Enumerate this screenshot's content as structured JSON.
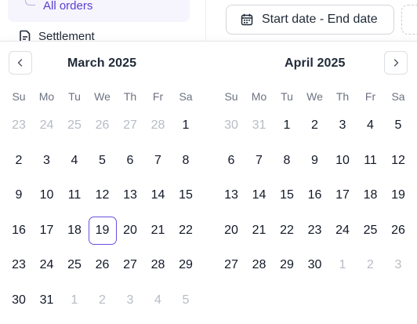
{
  "sidebar": {
    "active_item": "All orders",
    "next_item": "Settlement"
  },
  "toolbar": {
    "date_range_placeholder": "Start date - End date"
  },
  "calendar": {
    "weekdays": [
      "Su",
      "Mo",
      "Tu",
      "We",
      "Th",
      "Fr",
      "Sa"
    ],
    "months": [
      {
        "title": "March 2025",
        "weeks": [
          [
            "23",
            "24",
            "25",
            "26",
            "27",
            "28",
            "1"
          ],
          [
            "2",
            "3",
            "4",
            "5",
            "6",
            "7",
            "8"
          ],
          [
            "9",
            "10",
            "11",
            "12",
            "13",
            "14",
            "15"
          ],
          [
            "16",
            "17",
            "18",
            "19",
            "20",
            "21",
            "22"
          ],
          [
            "23",
            "24",
            "25",
            "26",
            "27",
            "28",
            "29"
          ],
          [
            "30",
            "31",
            "1",
            "2",
            "3",
            "4",
            "5"
          ]
        ],
        "outside": [
          [
            true,
            true,
            true,
            true,
            true,
            true,
            false
          ],
          [
            false,
            false,
            false,
            false,
            false,
            false,
            false
          ],
          [
            false,
            false,
            false,
            false,
            false,
            false,
            false
          ],
          [
            false,
            false,
            false,
            false,
            false,
            false,
            false
          ],
          [
            false,
            false,
            false,
            false,
            false,
            false,
            false
          ],
          [
            false,
            false,
            true,
            true,
            true,
            true,
            true
          ]
        ]
      },
      {
        "title": "April 2025",
        "weeks": [
          [
            "30",
            "31",
            "1",
            "2",
            "3",
            "4",
            "5"
          ],
          [
            "6",
            "7",
            "8",
            "9",
            "10",
            "11",
            "12"
          ],
          [
            "13",
            "14",
            "15",
            "16",
            "17",
            "18",
            "19"
          ],
          [
            "20",
            "21",
            "22",
            "23",
            "24",
            "25",
            "26"
          ],
          [
            "27",
            "28",
            "29",
            "30",
            "1",
            "2",
            "3"
          ]
        ],
        "outside": [
          [
            true,
            true,
            false,
            false,
            false,
            false,
            false
          ],
          [
            false,
            false,
            false,
            false,
            false,
            false,
            false
          ],
          [
            false,
            false,
            false,
            false,
            false,
            false,
            false
          ],
          [
            false,
            false,
            false,
            false,
            false,
            false,
            false
          ],
          [
            false,
            false,
            false,
            false,
            true,
            true,
            true
          ]
        ]
      }
    ],
    "today": {
      "month": 0,
      "week": 3,
      "day": 3
    },
    "colors": {
      "accent": "#6d4fe0",
      "accent_text": "#5b3fd1",
      "muted": "#b7bcc5"
    },
    "icons": {
      "prev": "chevron-left-icon",
      "next": "chevron-right-icon",
      "date": "calendar-icon",
      "settlement": "document-icon"
    }
  }
}
